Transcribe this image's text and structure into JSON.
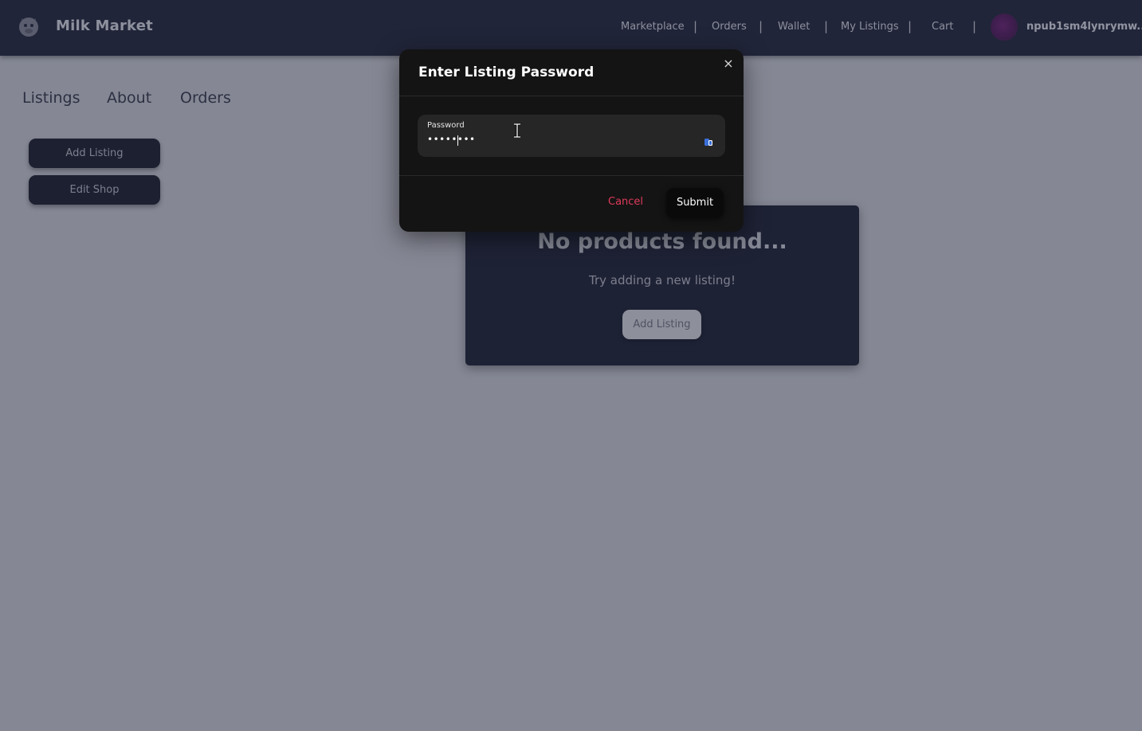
{
  "header": {
    "brand": "Milk Market",
    "nav": [
      "Marketplace",
      "Orders",
      "Wallet",
      "My Listings",
      "Cart"
    ],
    "separator": "|",
    "user_name": "npub1sm4lynrymw...",
    "logo_icon": "milk-market-logo-icon",
    "avatar_icon": "user-avatar"
  },
  "page": {
    "tabs": [
      "Listings",
      "About",
      "Orders"
    ],
    "sidebar_buttons": {
      "add_listing": "Add Listing",
      "edit_shop": "Edit Shop"
    },
    "empty_state": {
      "title": "No products found...",
      "subtitle": "Try adding a new listing!",
      "button": "Add Listing"
    }
  },
  "modal": {
    "title": "Enter Listing Password",
    "close_symbol": "×",
    "password_label": "Password",
    "password_value": "••••••••",
    "reveal_icon": "password-reveal-icon",
    "cancel": "Cancel",
    "submit": "Submit"
  },
  "colors": {
    "header_bg": "#2b2f42",
    "modal_bg": "#141414",
    "cancel": "#e03a5a"
  }
}
